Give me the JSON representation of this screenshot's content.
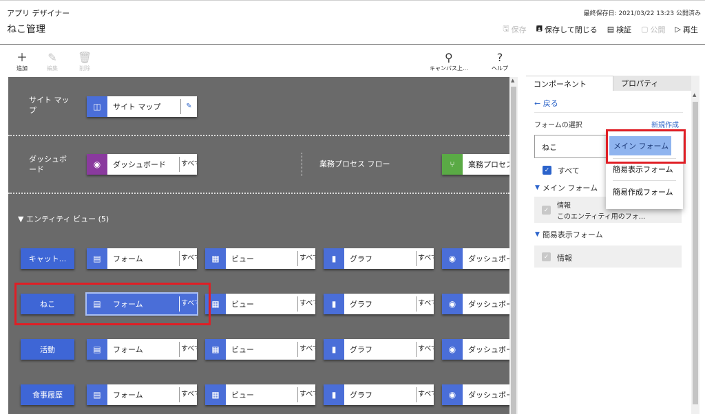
{
  "header": {
    "app_name": "アプリ デザイナー",
    "doc_title": "ねこ管理",
    "last_saved": "最終保存日: 2021/03/22 13:23 公開済み",
    "commands": [
      {
        "label": "保存",
        "icon": "save-icon",
        "glyph": "🖫",
        "enabled": false
      },
      {
        "label": "保存して閉じる",
        "icon": "save-close-icon",
        "glyph": "🖪",
        "enabled": true
      },
      {
        "label": "検証",
        "icon": "validate-icon",
        "glyph": "▤",
        "enabled": true
      },
      {
        "label": "公開",
        "icon": "publish-icon",
        "glyph": "▢",
        "enabled": false
      },
      {
        "label": "再生",
        "icon": "play-icon",
        "glyph": "▷",
        "enabled": true
      }
    ]
  },
  "toolbar": {
    "add": "追加",
    "edit": "編集",
    "delete": "削除",
    "canvas_search": "キャンバス上...",
    "help": "ヘルプ"
  },
  "canvas": {
    "sitemap": {
      "label": "サイト マップ",
      "tile": "サイト マップ"
    },
    "dashboard": {
      "label": "ダッシュボード",
      "tile": "ダッシュボード",
      "all": "すべて"
    },
    "bpf": {
      "label": "業務プロセス フロー",
      "tile": "業務プロセス"
    },
    "entity_view_header": "エンティティ ビュー (5)",
    "all_text": "すべて",
    "tile_form": "フォーム",
    "tile_view": "ビュー",
    "tile_chart": "グラフ",
    "tile_dashboard": "ダッシュボー",
    "entities": [
      "キャット...",
      "ねこ",
      "活動",
      "食事履歴"
    ]
  },
  "panel": {
    "tabs": [
      "コンポーネント",
      "プロパティ"
    ],
    "back": "戻る",
    "form_select_label": "フォームの選択",
    "new_link": "新規作成",
    "form_value": "ねこ",
    "all_label": "すべて",
    "main_form_group": "メイン フォーム",
    "main_item_title": "情報",
    "main_item_desc": "このエンティティ用のフォ...",
    "quick_view_group": "簡易表示フォーム",
    "quick_item_title": "情報",
    "dropdown": [
      "メイン フォーム",
      "簡易表示フォーム",
      "簡易作成フォーム"
    ]
  },
  "colors": {
    "canvas_bg": "#6a6a6a",
    "entity_blue": "#3e66d6",
    "form_icon": "#4a6ed8",
    "dashboard_icon": "#8a3a9e",
    "bpf_icon": "#5aaa45",
    "highlight_red": "#e01e25"
  }
}
